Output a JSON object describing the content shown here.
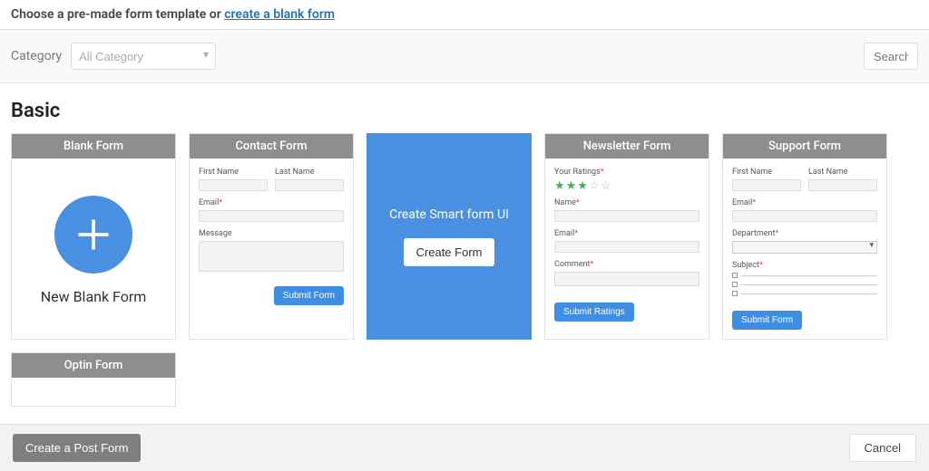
{
  "topbar": {
    "prefix": "Choose a pre-made form template or ",
    "link": "create a blank form"
  },
  "filter": {
    "category_label": "Category",
    "category_placeholder": "All Category",
    "search_placeholder": "Search"
  },
  "section_title": "Basic",
  "cards": {
    "blank": {
      "title": "Blank Form",
      "label": "New Blank Form"
    },
    "contact": {
      "title": "Contact Form",
      "first_name": "First Name",
      "last_name": "Last Name",
      "email": "Email",
      "message": "Message",
      "submit": "Submit Form"
    },
    "smart": {
      "text": "Create Smart form UI",
      "button": "Create Form"
    },
    "newsletter": {
      "title": "Newsletter Form",
      "ratings": "Your Ratings",
      "name": "Name",
      "email": "Email",
      "comment": "Comment",
      "submit": "Submit Ratings"
    },
    "support": {
      "title": "Support Form",
      "first_name": "First Name",
      "last_name": "Last Name",
      "email": "Email",
      "department": "Department",
      "subject": "Subject",
      "submit": "Submit Form"
    },
    "optin": {
      "title": "Optin Form"
    }
  },
  "footer": {
    "create_post": "Create a Post Form",
    "cancel": "Cancel"
  }
}
